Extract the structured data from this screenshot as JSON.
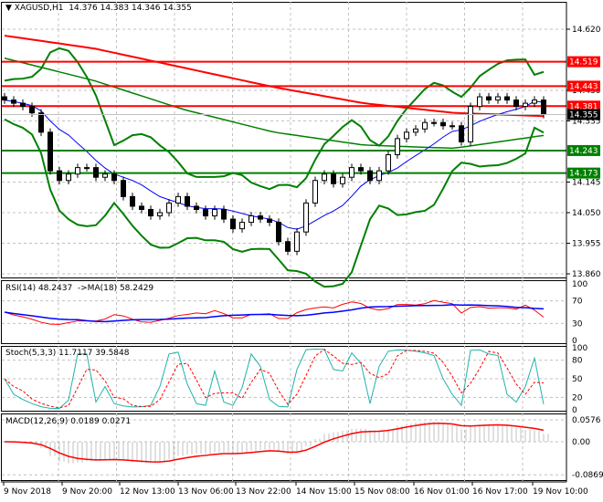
{
  "header": {
    "symbol": "XAGUSD,H1",
    "ohlc": "14.376 14.383 14.346 14.355"
  },
  "colors": {
    "up": "#000000",
    "down": "#000000",
    "bull_body": "#ffffff",
    "bear_body": "#000000",
    "bollinger": "#008000",
    "ma_long": "#ff0000",
    "resistance": "#ff0000",
    "support": "#008000",
    "rsi": "#ff0000",
    "rsi_ma": "#0000ff",
    "stoch_main": "#20b2aa",
    "stoch_signal": "#ff0000",
    "macd_hist": "#c0c0c0",
    "macd_signal": "#ff0000"
  },
  "price_axis": {
    "ticks": [
      "14.620",
      "14.430",
      "14.335",
      "14.145",
      "14.050",
      "13.955",
      "13.860"
    ],
    "current": "14.355"
  },
  "levels": [
    {
      "label": "14.519",
      "value": 14.519,
      "type": "resistance"
    },
    {
      "label": "14.443",
      "value": 14.443,
      "type": "resistance"
    },
    {
      "label": "14.381",
      "value": 14.381,
      "type": "resistance"
    },
    {
      "label": "14.243",
      "value": 14.243,
      "type": "support"
    },
    {
      "label": "14.173",
      "value": 14.173,
      "type": "support"
    }
  ],
  "rsi": {
    "label": "RSI(14) 48.2437  ->MA(18) 58.2429",
    "ticks": [
      "100",
      "70",
      "30",
      "0"
    ]
  },
  "stoch": {
    "label": "Stoch(5,3,3) 11.7117 39.5848",
    "ticks": [
      "100",
      "80",
      "50",
      "20",
      "0"
    ]
  },
  "macd": {
    "label": "MACD(12,26,9) 0.0189 0.0271",
    "ticks": [
      "0.0576",
      "0.00",
      "-0.0869"
    ]
  },
  "time_axis": [
    "9 Nov 2018",
    "9 Nov 20:00",
    "12 Nov 13:00",
    "13 Nov 06:00",
    "13 Nov 22:00",
    "14 Nov 15:00",
    "15 Nov 08:00",
    "16 Nov 01:00",
    "16 Nov 17:00",
    "19 Nov 10:00"
  ],
  "chart_data": {
    "type": "candlestick",
    "ylim": [
      13.86,
      14.62
    ],
    "closes": [
      14.4,
      14.39,
      14.38,
      14.36,
      14.3,
      14.18,
      14.15,
      14.17,
      14.19,
      14.19,
      14.16,
      14.17,
      14.15,
      14.1,
      14.07,
      14.06,
      14.04,
      14.05,
      14.08,
      14.1,
      14.07,
      14.06,
      14.04,
      14.06,
      14.03,
      14.0,
      14.02,
      14.04,
      14.03,
      14.02,
      13.96,
      13.93,
      13.99,
      14.08,
      14.15,
      14.17,
      14.14,
      14.16,
      14.19,
      14.18,
      14.15,
      14.18,
      14.23,
      14.28,
      14.3,
      14.31,
      14.33,
      14.33,
      14.32,
      14.32,
      14.27,
      14.38,
      14.41,
      14.4,
      14.41,
      14.4,
      14.38,
      14.39,
      14.4,
      14.355
    ],
    "ma_long": [
      14.6,
      14.56,
      14.5,
      14.44,
      14.39,
      14.36,
      14.35
    ],
    "ma_mid": [
      14.53,
      14.46,
      14.37,
      14.3,
      14.26,
      14.25,
      14.29
    ]
  }
}
